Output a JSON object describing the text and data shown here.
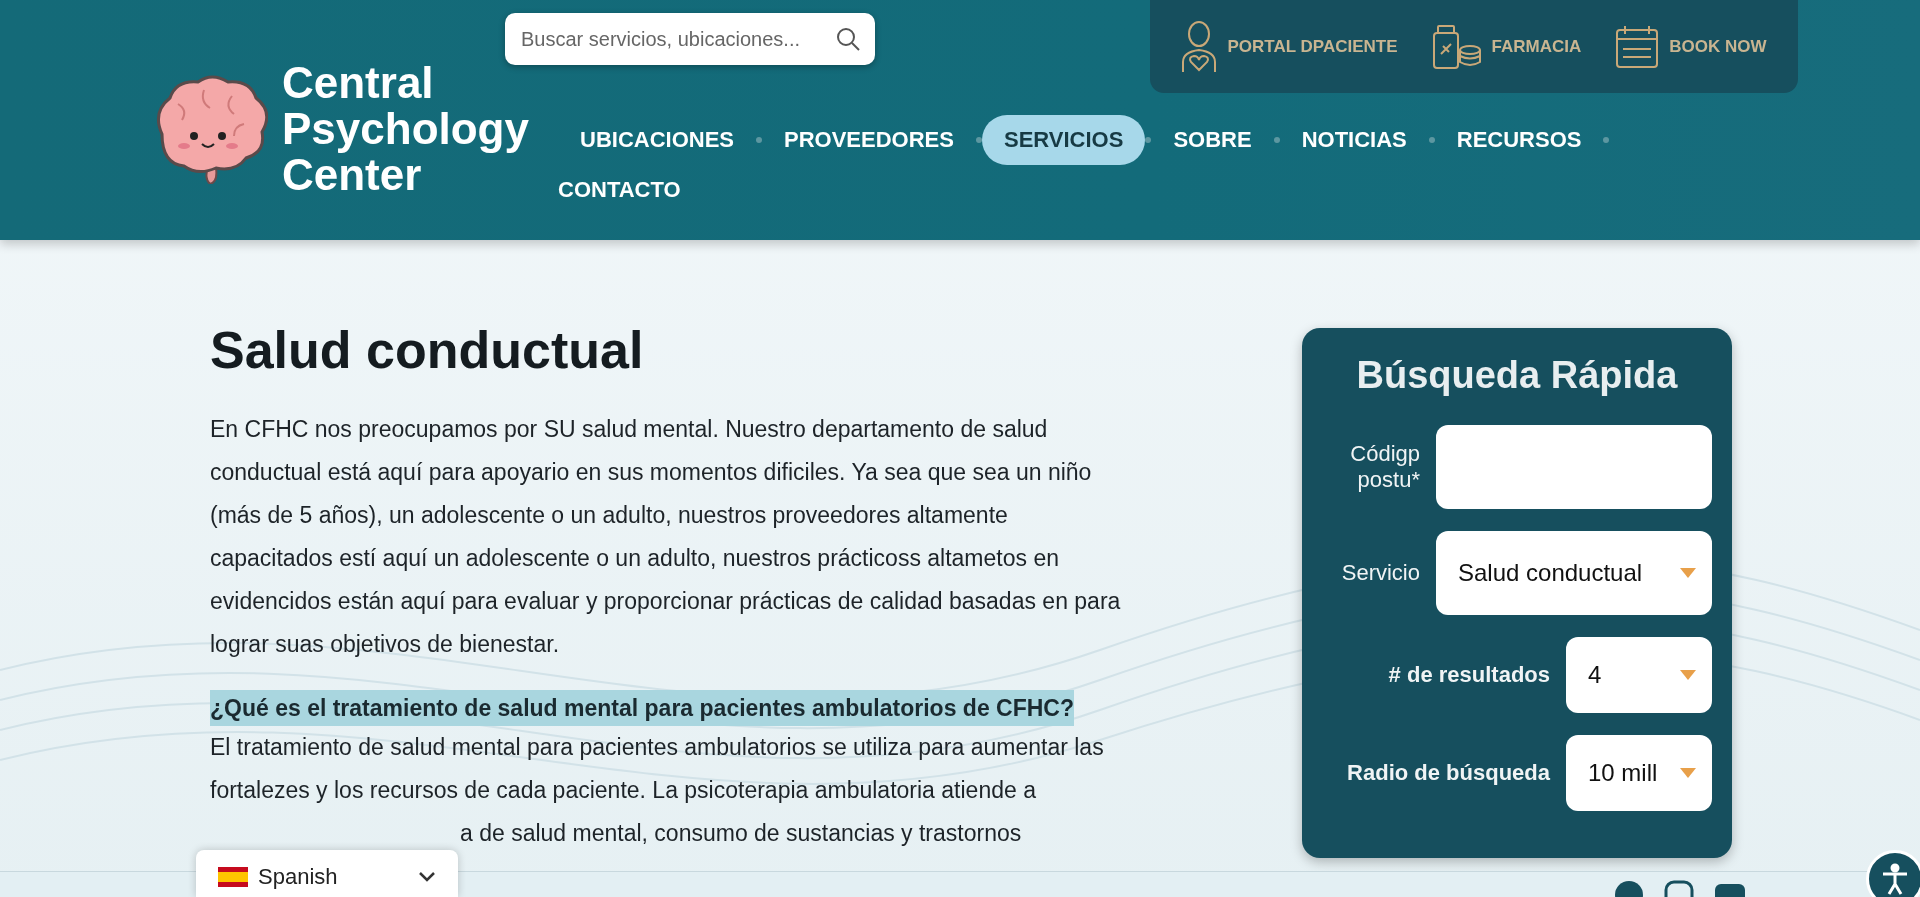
{
  "header": {
    "logo_text": "Central Psychology Center",
    "search": {
      "placeholder": "Buscar servicios, ubicaciones..."
    },
    "quick_links": [
      {
        "kind": "patient",
        "label": "PORTAL DPACIENTE"
      },
      {
        "kind": "pharmacy",
        "label": "FARMACIA"
      },
      {
        "kind": "calendar",
        "label": "BOOK NOW"
      }
    ],
    "nav": [
      {
        "label": "UBICACIONES",
        "selected": false
      },
      {
        "label": "PROVEEDORES",
        "selected": false
      },
      {
        "label": "SERVICIOS",
        "selected": true
      },
      {
        "label": "SOBRE",
        "selected": false
      },
      {
        "label": "NOTICIAS",
        "selected": false
      },
      {
        "label": "RECURSOS",
        "selected": false
      },
      {
        "label": "CONTACTO",
        "selected": false
      }
    ]
  },
  "main": {
    "title": "Salud conductual",
    "intro": "En CFHC nos preocupamos por SU salud mental. Nuestro departamento de salud conductual está aquí para apoyario en sus momentos dificiles. Ya sea que sea un niño (más de 5 años), un adolescente o un adulto, nuestros proveedores altamente capacitados estí aquí un adolescente o un adulto, nuestros prácticoss altametos en evidencidos están aquí para evaluar y proporcionar prácticas de calidad basadas en para lograr suas objetivos de bienestar.",
    "question": "¿Qué es el tratamiento de salud mental para pacientes ambulatorios de CFHC?",
    "answer": "El tratamiento de salud mental para pacientes ambulatorios se utiliza para aumentar las fortalezes y los recursos de cada paciente. La psicoterapia ambulatoria atiende a",
    "answer_tail": "a de salud mental, consumo de sustancias y trastornos"
  },
  "quick_search": {
    "title": "Búsqueda Rápida",
    "fields": [
      {
        "kind": "text",
        "label": "Códigp postu*"
      },
      {
        "kind": "select",
        "label": "Servicio",
        "value": "Salud conductual"
      },
      {
        "kind": "select",
        "label": "# de resultados",
        "value": "4"
      },
      {
        "kind": "select",
        "label": "Radio de búsqueda",
        "value": "10 mill"
      }
    ]
  },
  "language": {
    "label": "Spanish"
  }
}
